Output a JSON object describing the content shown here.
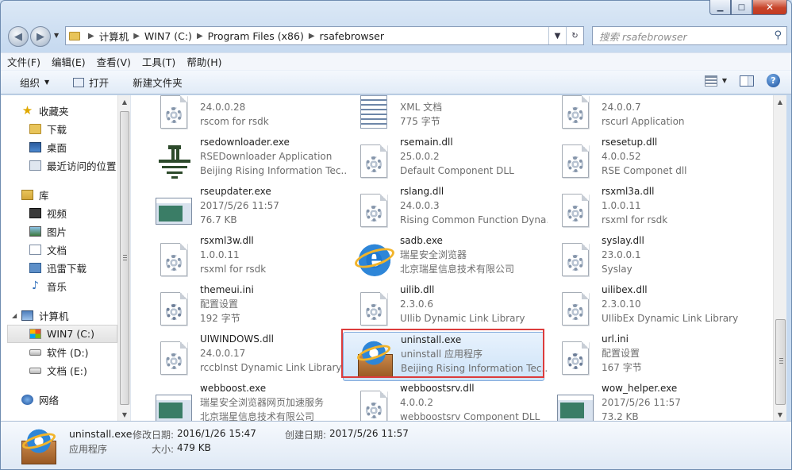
{
  "window": {
    "minimize_label": "▁",
    "maximize_label": "□",
    "close_label": "✕"
  },
  "address": {
    "crumbs": [
      "计算机",
      "WIN7 (C:)",
      "Program Files (x86)",
      "rsafebrowser"
    ],
    "search_placeholder": "搜索 rsafebrowser"
  },
  "menubar": {
    "items": [
      "文件(F)",
      "编辑(E)",
      "查看(V)",
      "工具(T)",
      "帮助(H)"
    ]
  },
  "cmdbar": {
    "organize": "组织",
    "open": "打开",
    "new_folder": "新建文件夹"
  },
  "navpane": {
    "favorites": "收藏夹",
    "downloads": "下载",
    "desktop": "桌面",
    "recent": "最近访问的位置",
    "libraries": "库",
    "videos": "视频",
    "pictures": "图片",
    "documents": "文档",
    "thunder": "迅雷下载",
    "music": "音乐",
    "computer": "计算机",
    "drive_c": "WIN7 (C:)",
    "drive_d": "软件 (D:)",
    "drive_e": "文档 (E:)",
    "network": "网络"
  },
  "files": [
    {
      "name": "",
      "line2": "24.0.0.28",
      "line3": "rscom for rsdk",
      "icon": "dll"
    },
    {
      "name": "",
      "line2": "XML 文档",
      "line3": "775 字节",
      "icon": "xml"
    },
    {
      "name": "",
      "line2": "24.0.0.7",
      "line3": "rscurl Application",
      "icon": "dll"
    },
    {
      "name": "rsedownloader.exe",
      "line2": "RSEDownloader Application",
      "line3": "Beijing Rising Information Tec...",
      "icon": "rsedl"
    },
    {
      "name": "rsemain.dll",
      "line2": "25.0.0.2",
      "line3": "Default Component DLL",
      "icon": "dll"
    },
    {
      "name": "rsesetup.dll",
      "line2": "4.0.0.52",
      "line3": "RSE Componet dll",
      "icon": "dll"
    },
    {
      "name": "rseupdater.exe",
      "line2": "2017/5/26 11:57",
      "line3": "76.7 KB",
      "icon": "app"
    },
    {
      "name": "rslang.dll",
      "line2": "24.0.0.3",
      "line3": "Rising Common Function Dyna...",
      "icon": "dll"
    },
    {
      "name": "rsxml3a.dll",
      "line2": "1.0.0.11",
      "line3": "rsxml for rsdk",
      "icon": "dll"
    },
    {
      "name": "rsxml3w.dll",
      "line2": "1.0.0.11",
      "line3": "rsxml for rsdk",
      "icon": "dll"
    },
    {
      "name": "sadb.exe",
      "line2": "瑞星安全浏览器",
      "line3": "北京瑞星信息技术有限公司",
      "icon": "ie"
    },
    {
      "name": "syslay.dll",
      "line2": "23.0.0.1",
      "line3": "Syslay",
      "icon": "dll"
    },
    {
      "name": "themeui.ini",
      "line2": "配置设置",
      "line3": "192 字节",
      "icon": "ini"
    },
    {
      "name": "uilib.dll",
      "line2": "2.3.0.6",
      "line3": "UIlib Dynamic Link Library",
      "icon": "dll"
    },
    {
      "name": "uilibex.dll",
      "line2": "2.3.0.10",
      "line3": "UIlibEx Dynamic Link Library",
      "icon": "dll"
    },
    {
      "name": "UIWINDOWS.dll",
      "line2": "24.0.0.17",
      "line3": "rccbInst Dynamic Link Library",
      "icon": "dll"
    },
    {
      "name": "uninstall.exe",
      "line2": "uninstall 应用程序",
      "line3": "Beijing Rising Information Tec...",
      "icon": "box",
      "selected": true
    },
    {
      "name": "url.ini",
      "line2": "配置设置",
      "line3": "167 字节",
      "icon": "ini"
    },
    {
      "name": "webboost.exe",
      "line2": "瑞星安全浏览器网页加速服务",
      "line3": "北京瑞星信息技术有限公司",
      "icon": "app"
    },
    {
      "name": "webboostsrv.dll",
      "line2": "4.0.0.2",
      "line3": "webboostsrv Component DLL",
      "icon": "dll"
    },
    {
      "name": "wow_helper.exe",
      "line2": "2017/5/26 11:57",
      "line3": "73.2 KB",
      "icon": "app"
    }
  ],
  "details": {
    "name": "uninstall.exe",
    "type": "应用程序",
    "modified_label": "修改日期:",
    "modified_value": "2016/1/26 15:47",
    "created_label": "创建日期:",
    "created_value": "2017/5/26 11:57",
    "size_label": "大小:",
    "size_value": "479 KB"
  }
}
